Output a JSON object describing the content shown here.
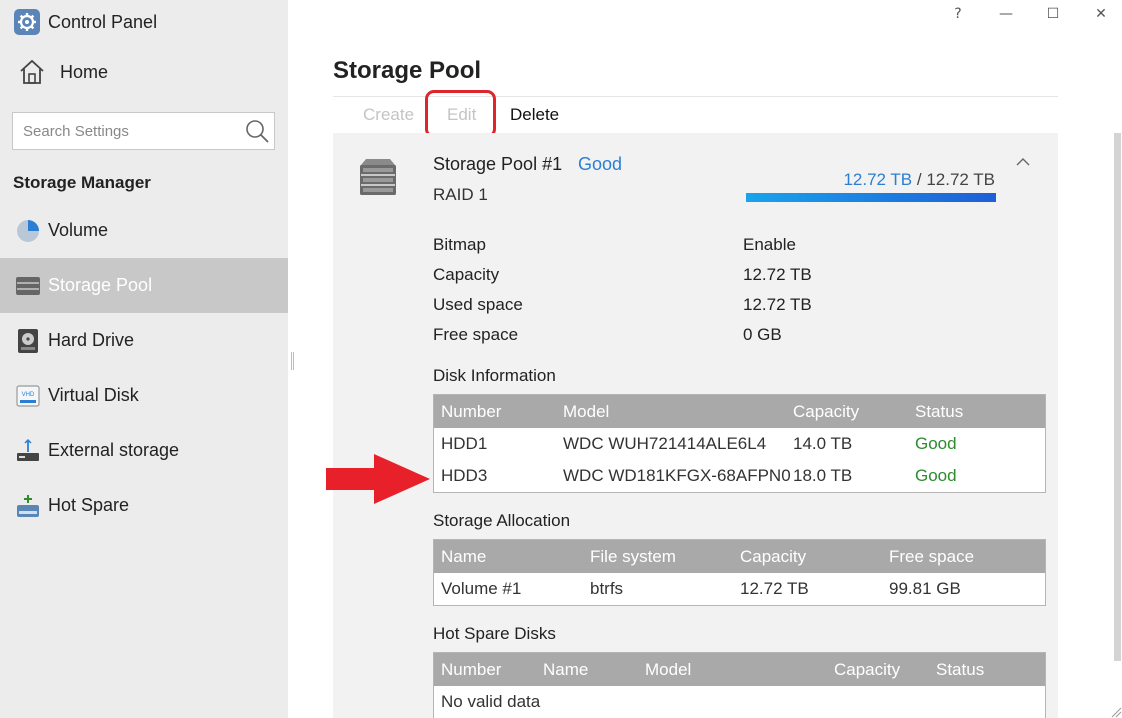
{
  "app": {
    "title": "Control Panel"
  },
  "window_controls": {
    "help": "?",
    "minimize": "—",
    "maximize": "☐",
    "close": "✕"
  },
  "sidebar": {
    "home_label": "Home",
    "search_placeholder": "Search Settings",
    "section_title": "Storage Manager",
    "items": [
      {
        "label": "Volume",
        "icon": "pie-chart-icon",
        "active": false
      },
      {
        "label": "Storage Pool",
        "icon": "storage-pool-icon",
        "active": true
      },
      {
        "label": "Hard Drive",
        "icon": "hard-drive-icon",
        "active": false
      },
      {
        "label": "Virtual Disk",
        "icon": "virtual-disk-icon",
        "active": false
      },
      {
        "label": "External storage",
        "icon": "usb-storage-icon",
        "active": false
      },
      {
        "label": "Hot Spare",
        "icon": "hot-spare-icon",
        "active": false
      }
    ]
  },
  "main": {
    "title": "Storage Pool",
    "toolbar": {
      "create": "Create",
      "edit": "Edit",
      "delete": "Delete"
    },
    "pool": {
      "name": "Storage Pool #1",
      "status": "Good",
      "raid": "RAID 1",
      "used": "12.72 TB",
      "separator": " / ",
      "total": "12.72 TB",
      "usage_fraction": 1.0,
      "details": [
        {
          "label": "Bitmap",
          "value": "Enable"
        },
        {
          "label": "Capacity",
          "value": "12.72 TB"
        },
        {
          "label": "Used space",
          "value": "12.72 TB"
        },
        {
          "label": "Free space",
          "value": "0 GB"
        }
      ]
    },
    "disk_info": {
      "title": "Disk Information",
      "headers": [
        "Number",
        "Model",
        "Capacity",
        "Status"
      ],
      "rows": [
        [
          "HDD1",
          "WDC WUH721414ALE6L4",
          "14.0 TB",
          "Good"
        ],
        [
          "HDD3",
          "WDC WD181KFGX-68AFPN0",
          "18.0 TB",
          "Good"
        ]
      ]
    },
    "allocation": {
      "title": "Storage Allocation",
      "headers": [
        "Name",
        "File system",
        "Capacity",
        "Free space"
      ],
      "rows": [
        [
          "Volume #1",
          "btrfs",
          "12.72 TB",
          "99.81 GB"
        ]
      ]
    },
    "hot_spare": {
      "title": "Hot Spare Disks",
      "headers": [
        "Number",
        "Name",
        "Model",
        "Capacity",
        "Status"
      ],
      "empty_text": "No valid data"
    }
  },
  "colors": {
    "accent": "#2a7fd4",
    "good": "#2e8b2e",
    "highlight": "#e0242b",
    "sidebar_active": "#c8c8c8"
  }
}
